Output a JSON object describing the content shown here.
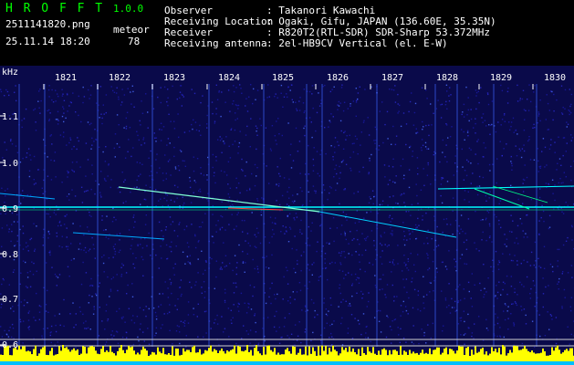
{
  "header": {
    "app_title": "H R O F F T",
    "version": "1.0.0",
    "filename": "2511141820.png",
    "datetime": "25.11.14 18:20",
    "detector_label": "meteor",
    "detector_count": "78",
    "info_labels": [
      "Observer",
      "Receiving Location",
      "Receiver",
      "Receiving antenna"
    ],
    "info_values": [
      ": Takanori Kawachi",
      ": Ogaki, Gifu, JAPAN (136.60E, 35.35N)",
      ": R820T2(RTL-SDR) SDR-Sharp 53.372MHz",
      ": 2el-HB9CV Vertical (el. E-W)"
    ]
  },
  "axis": {
    "y_unit": "kHz",
    "x_ticks": [
      "1821",
      "1822",
      "1823",
      "1824",
      "1825",
      "1826",
      "1827",
      "1828",
      "1829",
      "1830"
    ],
    "y_ticks": [
      "1.1",
      "1.0",
      "0.9",
      "0.8",
      "0.7",
      "0.6"
    ]
  },
  "colors": {
    "background": "#000000",
    "noise": "#1a1aa8",
    "signal": "#00ffff",
    "histogram": "#ffff00",
    "histogram_base": "#00bfff",
    "header_green": "#00ff00"
  }
}
